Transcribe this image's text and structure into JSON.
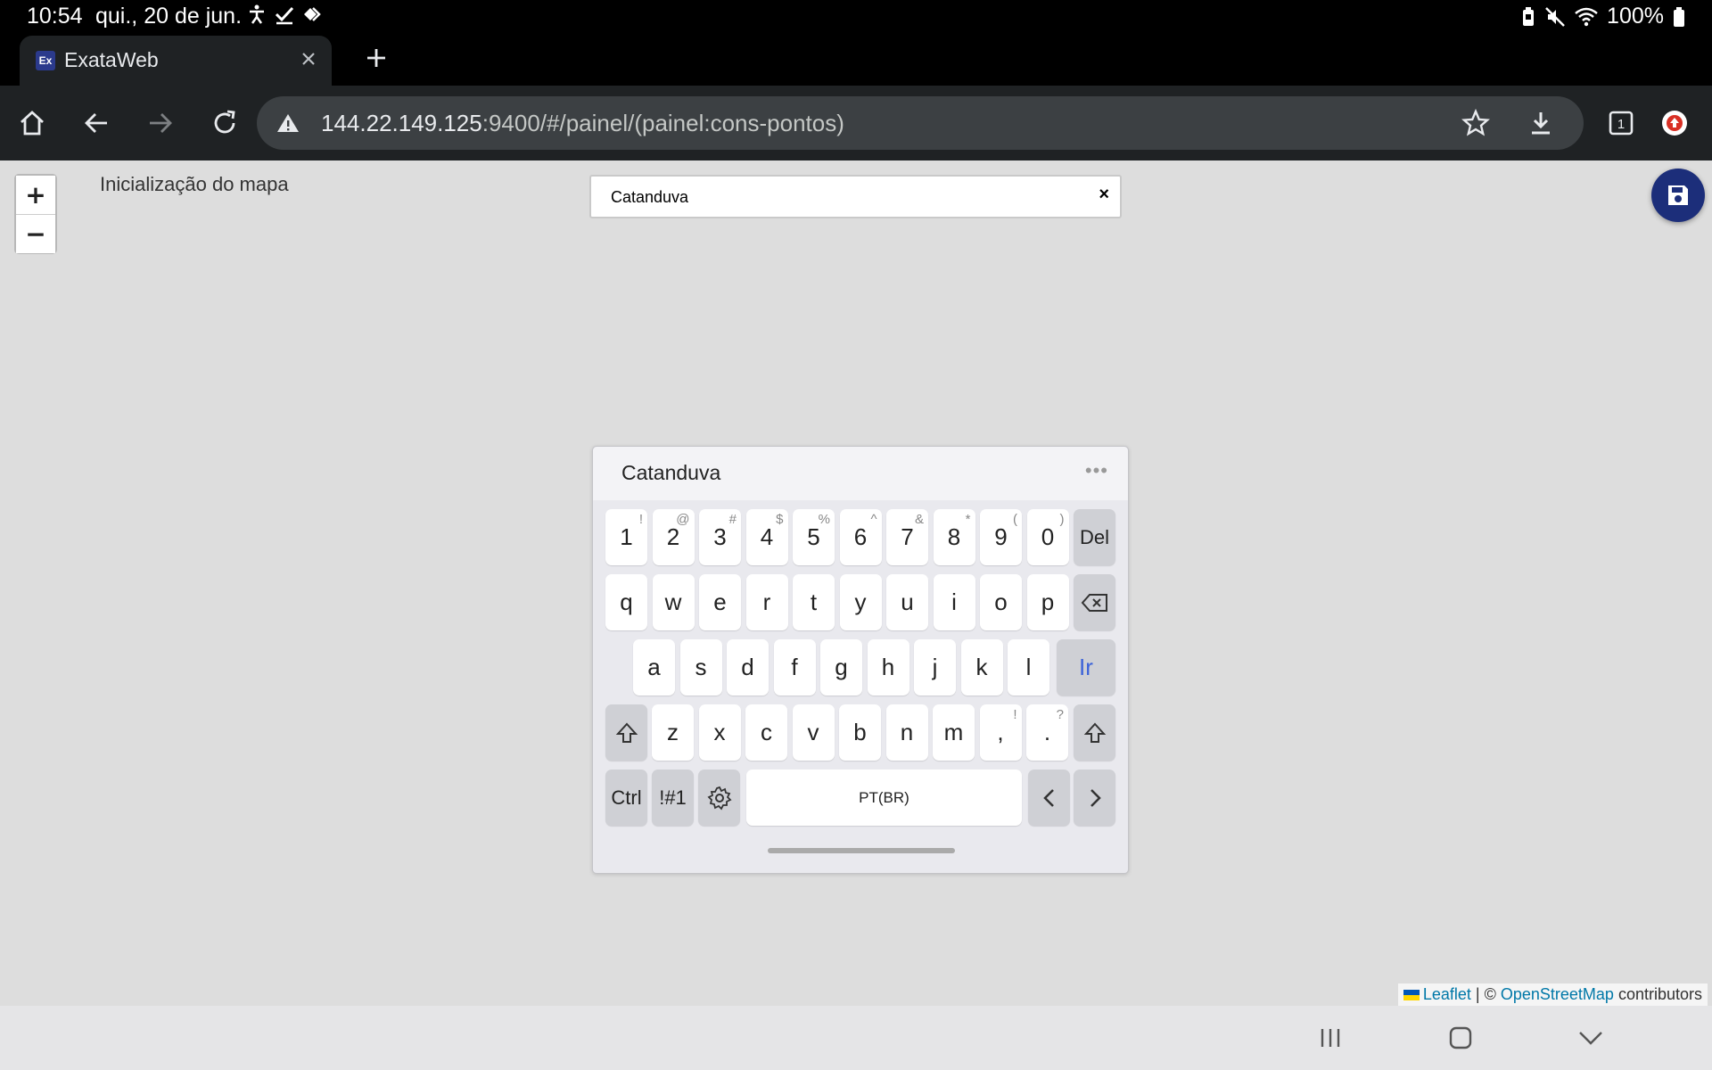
{
  "statusbar": {
    "time": "10:54",
    "date": "qui., 20 de jun.",
    "battery": "100%"
  },
  "tab": {
    "favicon": "Ex",
    "title": "ExataWeb"
  },
  "toolbar": {
    "url_host": "144.22.149.125",
    "url_path": ":9400/#/painel/(painel:cons-pontos)"
  },
  "map": {
    "zoom_in": "+",
    "zoom_out": "−",
    "status": "Inicialização do mapa",
    "search_value": "Catanduva",
    "search_clear": "×",
    "attribution": {
      "leaflet": "Leaflet",
      "sep": "| ©",
      "osm": "OpenStreetMap",
      "contributors": "contributors"
    }
  },
  "keyboard": {
    "suggestion": "Catanduva",
    "more": "•••",
    "row1": [
      {
        "k": "1",
        "s": "!"
      },
      {
        "k": "2",
        "s": "@"
      },
      {
        "k": "3",
        "s": "#"
      },
      {
        "k": "4",
        "s": "$"
      },
      {
        "k": "5",
        "s": "%"
      },
      {
        "k": "6",
        "s": "^"
      },
      {
        "k": "7",
        "s": "&"
      },
      {
        "k": "8",
        "s": "*"
      },
      {
        "k": "9",
        "s": "("
      },
      {
        "k": "0",
        "s": ")"
      }
    ],
    "del": "Del",
    "row2": [
      "q",
      "w",
      "e",
      "r",
      "t",
      "y",
      "u",
      "i",
      "o",
      "p"
    ],
    "row3": [
      "a",
      "s",
      "d",
      "f",
      "g",
      "h",
      "j",
      "k",
      "l"
    ],
    "go": "Ir",
    "row4": [
      "z",
      "x",
      "c",
      "v",
      "b",
      "n",
      "m"
    ],
    "comma": {
      "k": ",",
      "s": "!"
    },
    "period": {
      "k": ".",
      "s": "?"
    },
    "ctrl": "Ctrl",
    "sym": "!#1",
    "space": "PT(BR)"
  }
}
